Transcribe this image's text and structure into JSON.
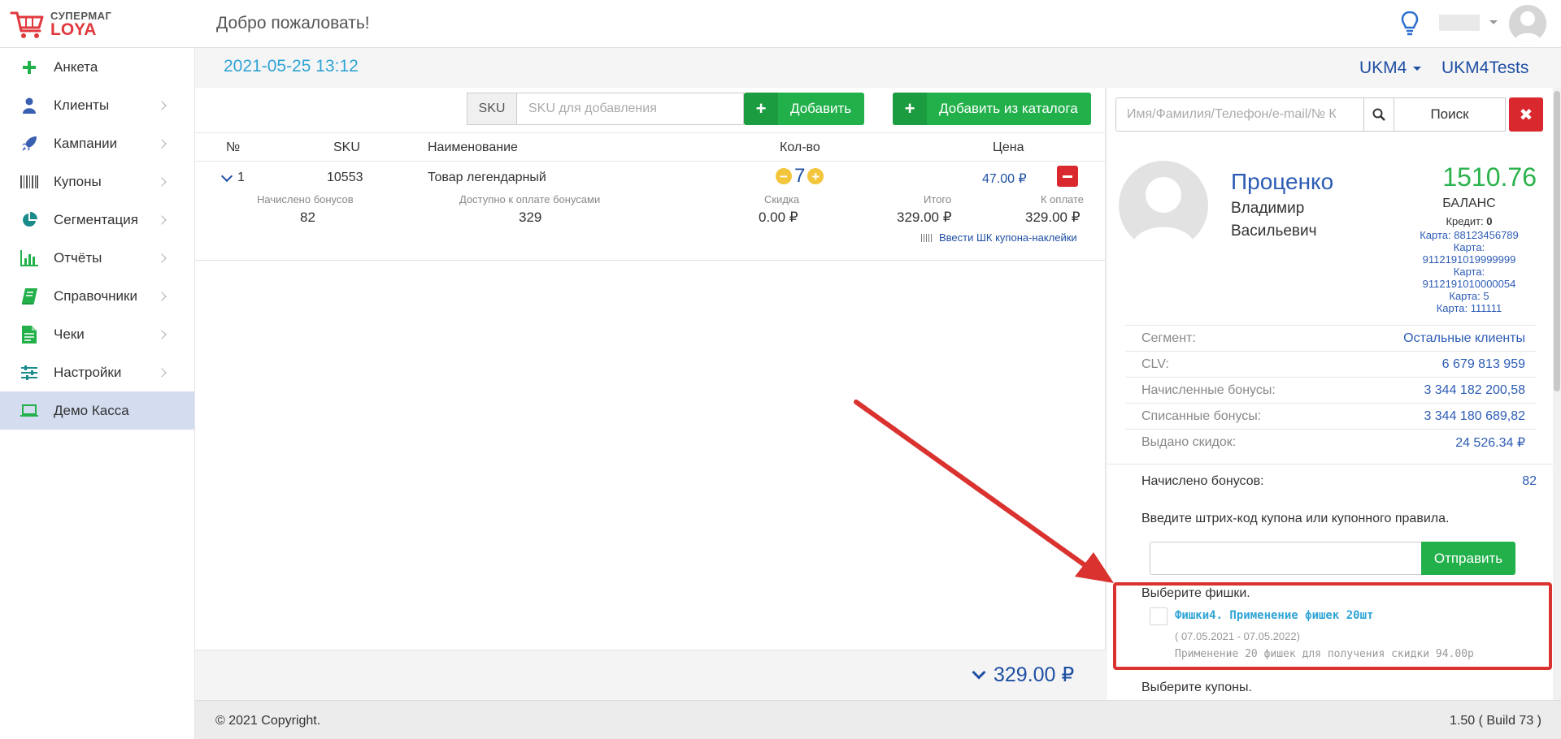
{
  "brand": {
    "line1": "СУПЕРМАГ",
    "line2": "LOYA"
  },
  "header": {
    "title": "Добро пожаловать!"
  },
  "sidebar": {
    "items": [
      {
        "label": "Анкета",
        "icon": "plus-icon"
      },
      {
        "label": "Клиенты",
        "icon": "user-icon"
      },
      {
        "label": "Кампании",
        "icon": "rocket-icon"
      },
      {
        "label": "Купоны",
        "icon": "barcode-icon"
      },
      {
        "label": "Сегментация",
        "icon": "pie-chart-icon"
      },
      {
        "label": "Отчёты",
        "icon": "bar-chart-icon"
      },
      {
        "label": "Справочники",
        "icon": "book-icon"
      },
      {
        "label": "Чеки",
        "icon": "receipt-icon"
      },
      {
        "label": "Настройки",
        "icon": "sliders-icon"
      },
      {
        "label": "Демо Касса",
        "icon": "laptop-icon",
        "active": true
      }
    ]
  },
  "content": {
    "datetime": "2021-05-25 13:12",
    "store": "UKM4",
    "store2": "UKM4Tests"
  },
  "toolbar": {
    "sku_addon": "SKU",
    "sku_placeholder": "SKU для добавления",
    "add_label": "Добавить",
    "catalog_label": "Добавить из каталога"
  },
  "table": {
    "headers": {
      "num": "№",
      "sku": "SKU",
      "name": "Наименование",
      "qty": "Кол-во",
      "price": "Цена"
    },
    "row": {
      "num": "1",
      "sku": "10553",
      "name": "Товар легендарный",
      "qty": "7",
      "price": "47.00 ₽",
      "bonus_label": "Начислено бонусов",
      "bonus_value": "82",
      "avail_label": "Доступно к оплате бонусами",
      "avail_value": "329",
      "discount_label": "Скидка",
      "discount_value": "0.00 ₽",
      "total_label": "Итого",
      "total_value": "329.00 ₽",
      "topay_label": "К оплате",
      "topay_value": "329.00 ₽",
      "coupon_link": "Ввести ШК купона-наклейки"
    }
  },
  "total": "329.00 ₽",
  "client": {
    "search_placeholder": "Имя/Фамилия/Телефон/e-mail/№ К",
    "search_label": "Поиск",
    "last_name": "Проценко",
    "first_name": "Владимир",
    "middle_name": "Васильевич",
    "balance": "1510.76",
    "balance_label": "БАЛАНС",
    "credit_label": "Кредит:",
    "credit_value": "0",
    "cards": [
      "Карта: 88123456789",
      "Карта:",
      "9112191019999999",
      "Карта:",
      "9112191010000054",
      "Карта: 5",
      "Карта: 111111"
    ],
    "stats": [
      {
        "label": "Сегмент:",
        "value": "Остальные клиенты"
      },
      {
        "label": "CLV:",
        "value": "6 679 813 959"
      },
      {
        "label": "Начисленные бонусы:",
        "value": "3 344 182 200,58"
      },
      {
        "label": "Списанные бонусы:",
        "value": "3 344 180 689,82"
      },
      {
        "label": "Выдано скидок:",
        "value": "24 526.34 ₽"
      }
    ],
    "earned_label": "Начислено бонусов:",
    "earned_value": "82",
    "coupon_prompt": "Введите штрих-код купона или купонного правила.",
    "send_label": "Отправить",
    "chips_title": "Выберите фишки.",
    "chip_name": "Фишки4. Применение фишек 20шт",
    "chip_dates": "( 07.05.2021 - 07.05.2022)",
    "chip_desc": "Применение 20 фишек для получения скидки 94.00р",
    "coupons_title": "Выберите купоны."
  },
  "footer": {
    "copyright": "© 2021 Copyright.",
    "version": "1.50 ( Build 73 )"
  },
  "colors": {
    "accent": "#1f4fa3",
    "green": "#22b04b",
    "red": "#d9282e",
    "active_nav": "#d4dcf0"
  }
}
